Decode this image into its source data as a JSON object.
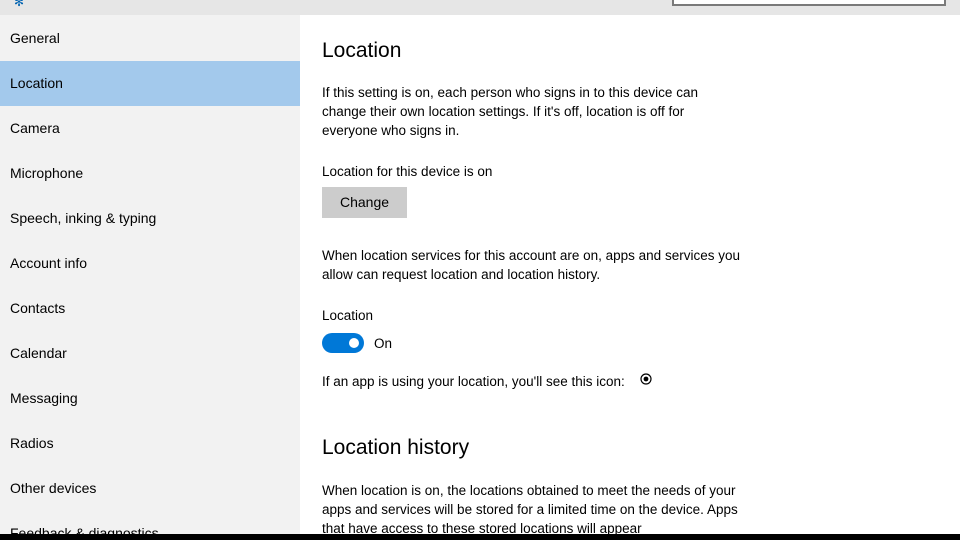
{
  "sidebar": {
    "items": [
      {
        "label": "General"
      },
      {
        "label": "Location"
      },
      {
        "label": "Camera"
      },
      {
        "label": "Microphone"
      },
      {
        "label": "Speech, inking & typing"
      },
      {
        "label": "Account info"
      },
      {
        "label": "Contacts"
      },
      {
        "label": "Calendar"
      },
      {
        "label": "Messaging"
      },
      {
        "label": "Radios"
      },
      {
        "label": "Other devices"
      },
      {
        "label": "Feedback & diagnostics"
      }
    ],
    "selected": "Location"
  },
  "main": {
    "title": "Location",
    "intro": "If this setting is on, each person who signs in to this device can change their own location settings. If it's off, location is off for everyone who signs in.",
    "device_status": "Location for this device is on",
    "change_button": "Change",
    "services_text": "When location services for this account are on, apps and services you allow can request location and location history.",
    "toggle_label": "Location",
    "toggle_state": "On",
    "icon_hint": "If an app is using your location, you'll see this icon:",
    "icon_hint_icon": "location-in-use-icon",
    "history_title": "Location history",
    "history_text": "When location is on, the locations obtained to meet the needs of your apps and services will be stored for a limited time on the device. Apps that have access to these stored locations will appear"
  },
  "colors": {
    "accent": "#0078d7",
    "selected_bg": "#a3c9ec",
    "sidebar_bg": "#f2f2f2",
    "button_bg": "#cccccc"
  }
}
